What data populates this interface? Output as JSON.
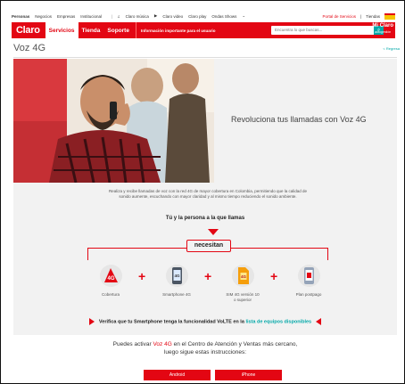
{
  "topbar": {
    "segments": [
      "Personas",
      "Negocios",
      "Empresas",
      "Institucional"
    ],
    "links": [
      "Claro música",
      "Claro video",
      "Claro play",
      "Ondas Shows"
    ],
    "right": [
      "Portal de Servicios",
      "Tiendas"
    ]
  },
  "header": {
    "logo": "Claro",
    "nav": [
      "Servicios",
      "Tienda",
      "Soporte"
    ],
    "notice": "Información importante para el usuario",
    "search_placeholder": "Encuentra lo que buscas...",
    "account": "Mi Claro",
    "account_sub": "autogestión"
  },
  "page": {
    "title": "Voz 4G",
    "back": "< Regresa"
  },
  "hero": {
    "headline": "Revoluciona tus llamadas con Voz 4G"
  },
  "steps": {
    "intro": "Realiza y recibe llamadas de voz con la red 4G de mayor cobertura en Colombia, permitiendo que la calidad de sonido aumente, escuchando con mayor claridad y al mismo tiempo reduciendo el sonido ambiente.",
    "subtitle": "Tú y la persona a la que llamas",
    "needs": "necesitan",
    "items": [
      {
        "badge": "4G",
        "label": "Cobertura"
      },
      {
        "badge": "4G",
        "label": "Smartphone 4G"
      },
      {
        "badge": "4G",
        "label": "SIM 4G versión 10 o superior"
      },
      {
        "badge": "",
        "label": "Plan postpago"
      }
    ],
    "plus": "+",
    "verify_prefix": "Verifica que tu Smartphone tenga la funcionalidad VoLTE en la ",
    "verify_link": "lista de equipos disponibles"
  },
  "activation": {
    "pre": "Puedes activar ",
    "highlight": "Voz 4G",
    "post": " en el Centro de Atención y Ventas más cercano, luego sigue estas instrucciones:",
    "buttons": [
      "Android",
      "iPhone"
    ]
  },
  "colors": {
    "brand": "#e30613",
    "accent": "#00a8a8"
  }
}
